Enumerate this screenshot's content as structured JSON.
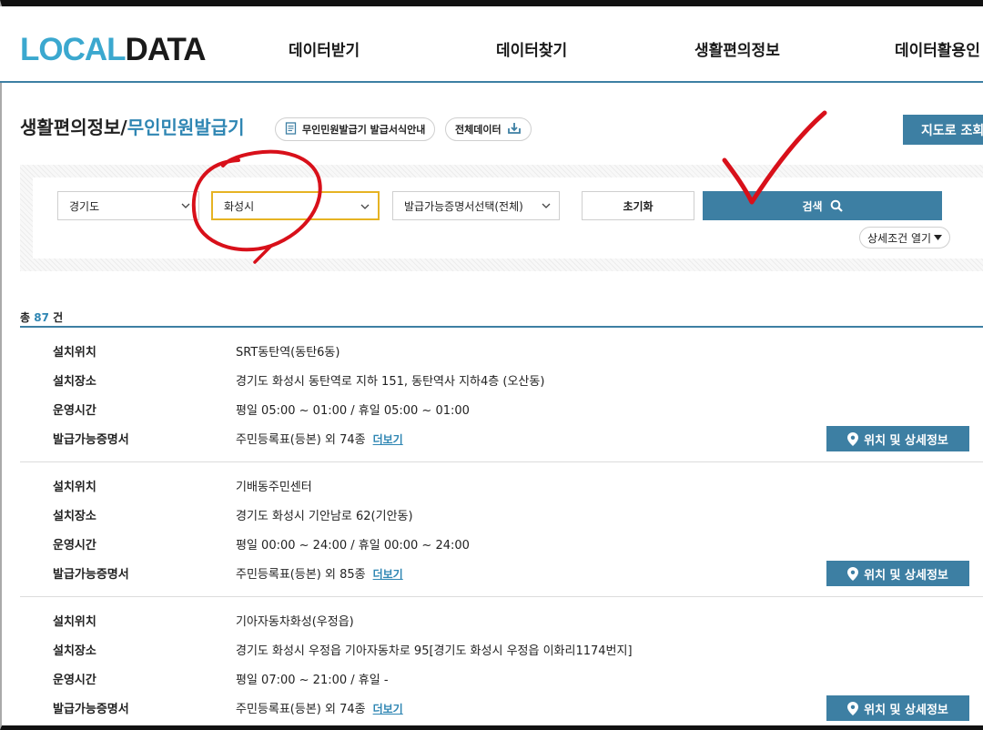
{
  "header": {
    "logo_local": "LOCAL",
    "logo_data": "DATA",
    "nav": [
      "데이터받기",
      "데이터찾기",
      "생활편의정보",
      "데이터활용인"
    ]
  },
  "title": {
    "main": "생활편의정보",
    "separator": "/",
    "sub": "무인민원발급기"
  },
  "pills": {
    "guide": "무인민원발급기 발급서식안내",
    "all_data": "전체데이터"
  },
  "map_button": "지도로 조회",
  "search": {
    "province": "경기도",
    "city": "화성시",
    "certificate": "발급가능증명서선택(전체)",
    "reset": "초기화",
    "search": "검색",
    "detail_toggle": "상세조건 열기"
  },
  "result": {
    "prefix": "총",
    "count": "87",
    "suffix": "건"
  },
  "labels": {
    "location": "설치위치",
    "place": "설치장소",
    "hours": "운영시간",
    "certs": "발급가능증명서",
    "more": "더보기",
    "detail_btn": "위치 및 상세정보"
  },
  "records": [
    {
      "location": "SRT동탄역(동탄6동)",
      "place": "경기도 화성시 동탄역로 지하 151, 동탄역사 지하4층 (오산동)",
      "hours": "평일 05:00 ~ 01:00 / 휴일 05:00 ~ 01:00",
      "certs": "주민등록표(등본) 외 74종"
    },
    {
      "location": "기배동주민센터",
      "place": "경기도 화성시 기안남로 62(기안동)",
      "hours": "평일 00:00 ~ 24:00 / 휴일 00:00 ~ 24:00",
      "certs": "주민등록표(등본) 외 85종"
    },
    {
      "location": "기아자동차화성(우정읍)",
      "place": "경기도 화성시 우정읍 기아자동차로 95[경기도 화성시 우정읍 이화리1174번지]",
      "hours": "평일 07:00 ~ 21:00 / 휴일 -",
      "certs": "주민등록표(등본) 외 74종"
    }
  ],
  "colors": {
    "accent": "#3d7fa3",
    "logo_blue": "#3ba8cf",
    "highlight": "#e6b323",
    "annotation_red": "#d8101a"
  }
}
